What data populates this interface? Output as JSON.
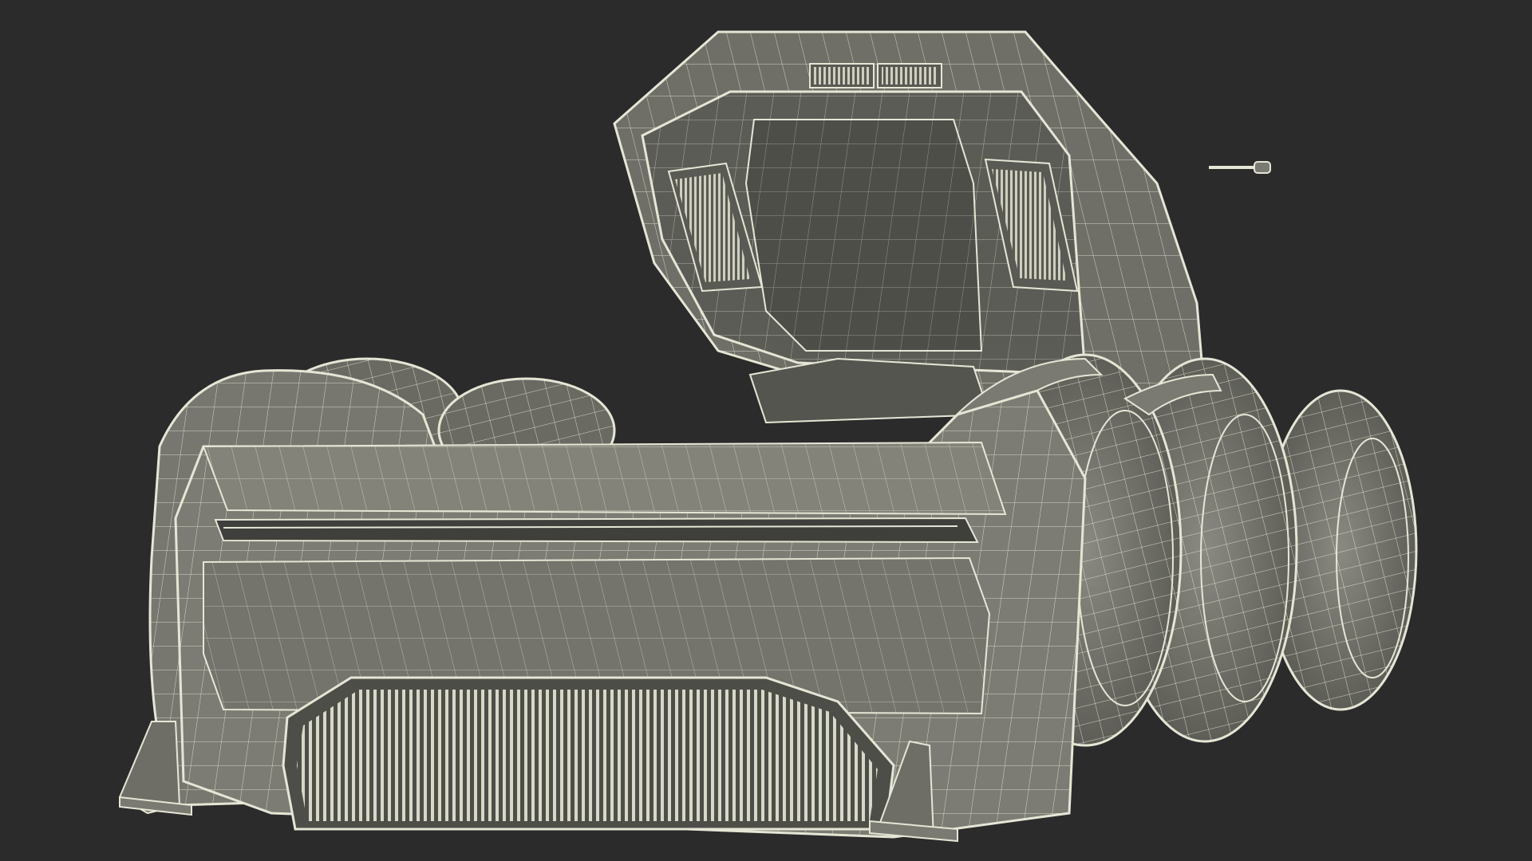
{
  "scene": {
    "subject": "",
    "background_color": "#2b2b2b",
    "model_fill_color": "#7a7a72",
    "model_shadow_color": "#5e5e58",
    "model_dark_color": "#4a4a45",
    "wire_color": "#e6e6d6"
  }
}
